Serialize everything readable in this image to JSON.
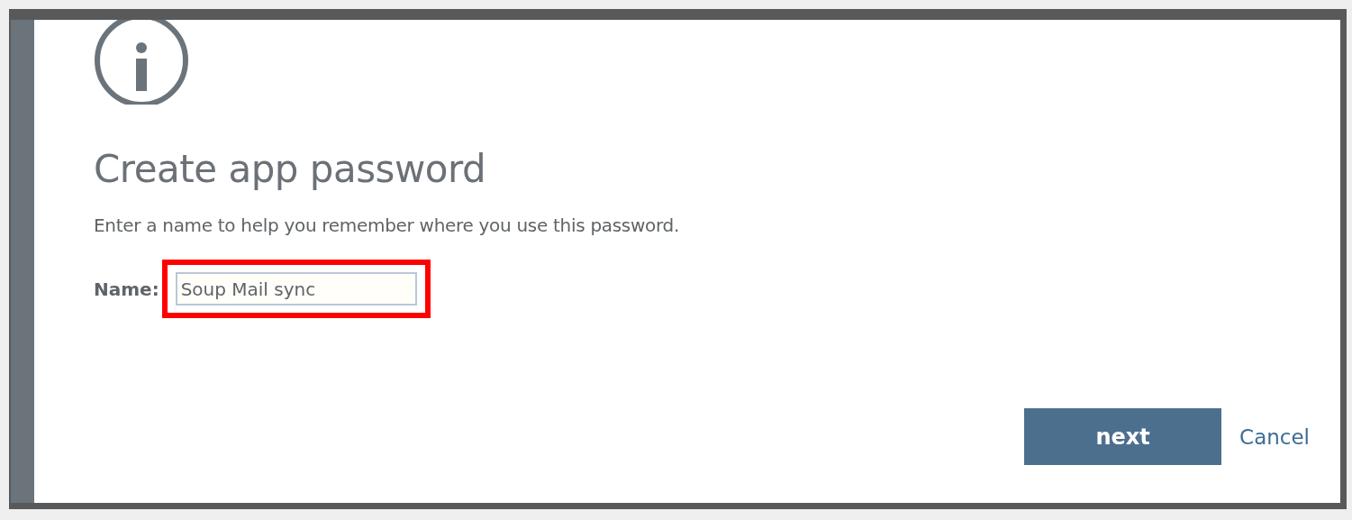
{
  "dialog": {
    "title": "Create app password",
    "description": "Enter a name to help you remember where you use this password.",
    "name_field": {
      "label": "Name:",
      "value": "Soup Mail sync",
      "highlighted": true
    },
    "buttons": [
      {
        "kind": "primary",
        "label": "next"
      },
      {
        "kind": "link",
        "label": "Cancel"
      }
    ]
  }
}
